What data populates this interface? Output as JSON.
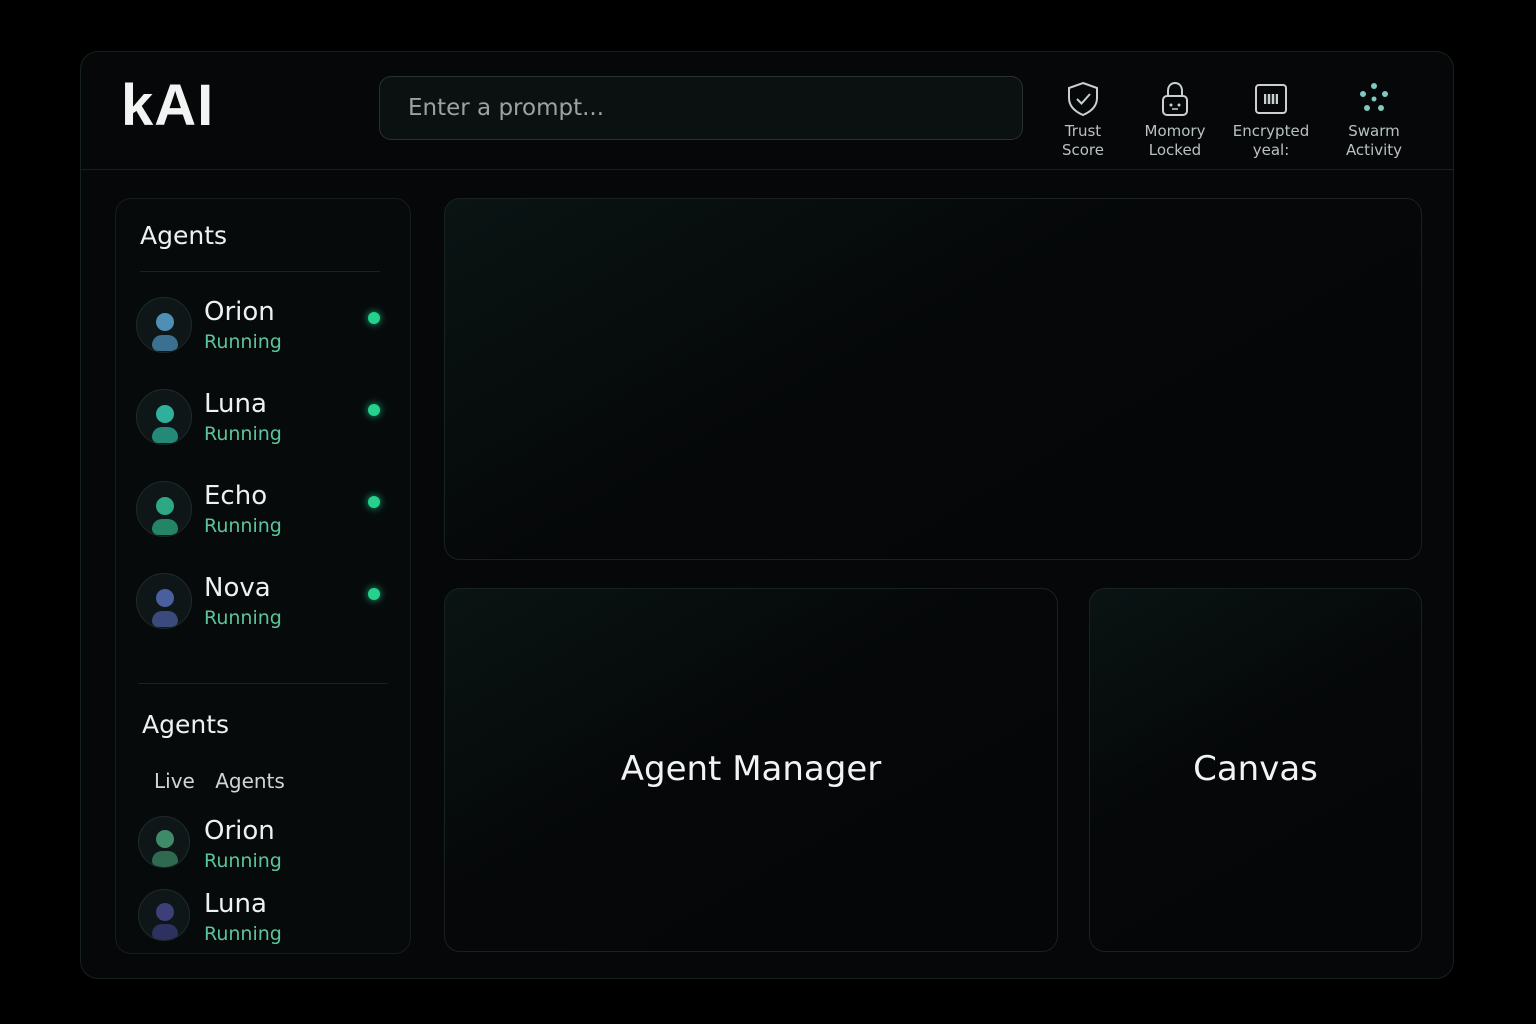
{
  "app": {
    "logo": "kAI"
  },
  "prompt": {
    "placeholder": "Enter a prompt..."
  },
  "status_items": [
    {
      "label": "Trust\nScore",
      "icon": "shield-check-icon"
    },
    {
      "label": "Momory\nLocked",
      "icon": "lock-icon"
    },
    {
      "label": "Encrypted\nyeal:",
      "icon": "vault-icon"
    },
    {
      "label": "Swarm\nActivity",
      "icon": "swarm-dots-icon"
    }
  ],
  "sidebar": {
    "title": "Agents",
    "agents": [
      {
        "name": "Orion",
        "status": "Running",
        "avatar_color": "#4f8fb5"
      },
      {
        "name": "Luna",
        "status": "Running",
        "avatar_color": "#2fb09a"
      },
      {
        "name": "Echo",
        "status": "Running",
        "avatar_color": "#2ea884"
      },
      {
        "name": "Nova",
        "status": "Running",
        "avatar_color": "#4a5f9e"
      }
    ],
    "section2_title": "Agents",
    "tabs": [
      "Live",
      "Agents"
    ],
    "live_agents": [
      {
        "name": "Orion",
        "status": "Running",
        "avatar_color": "#3f8a68"
      },
      {
        "name": "Luna",
        "status": "Running",
        "avatar_color": "#3c3f78"
      }
    ]
  },
  "panels": {
    "agent_manager": "Agent Manager",
    "canvas": "Canvas"
  },
  "colors": {
    "accent": "#24d28e",
    "status_text": "#5cc49a",
    "background": "#000000"
  }
}
